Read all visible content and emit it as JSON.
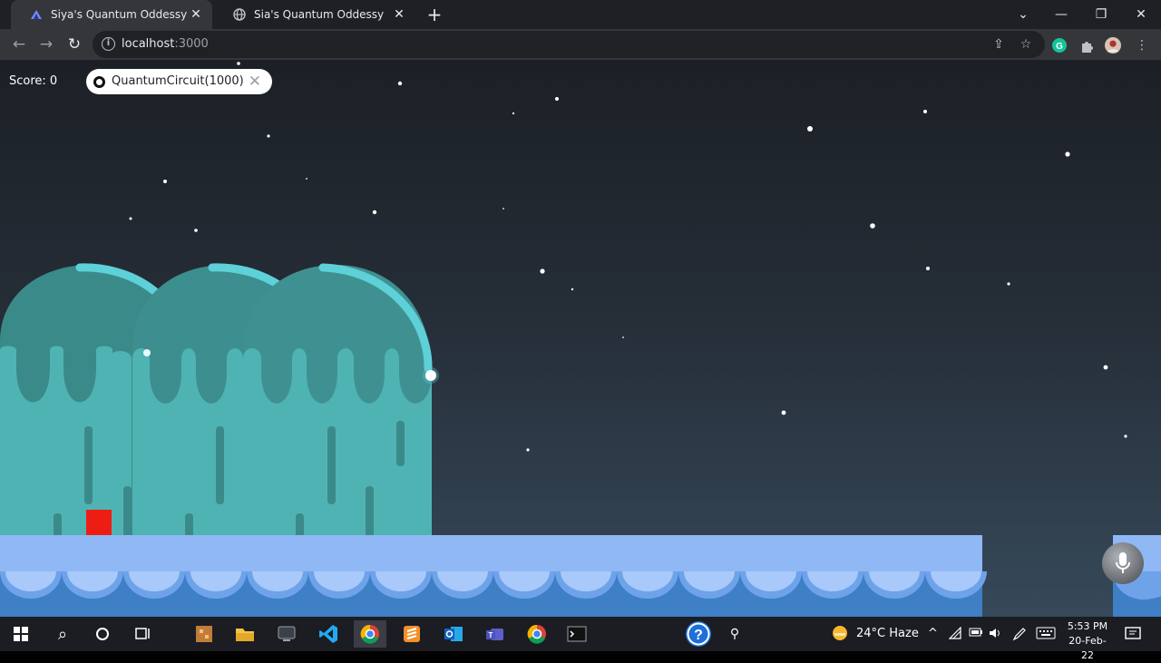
{
  "browser": {
    "tabs": [
      {
        "title": "Siya's Quantum Oddessy",
        "active": true
      },
      {
        "title": "Sia's Quantum Oddessy",
        "active": false
      }
    ],
    "new_tab": "+",
    "url_host": "localhost",
    "url_port": ":3000"
  },
  "game": {
    "score_label": "Score: 0",
    "search_value": "QuantumCircuit(1000)",
    "colors": {
      "jelly_body": "#4fb3b3",
      "jelly_dome": "#3d8c8c",
      "jelly_rim": "#5dd0d8",
      "ground": "#8fb8f5",
      "ground_dark": "#3e7fc6",
      "player": "#ee1d14"
    }
  },
  "taskbar": {
    "weather": "24°C  Haze",
    "time": "5:53 PM",
    "date": "20-Feb-22",
    "icons": [
      "windows-start-icon",
      "search-icon",
      "cortana-icon",
      "task-view-icon",
      "file-explorer-icon",
      "file-manager-icon",
      "screen-icon",
      "vscode-icon",
      "chrome-icon",
      "sublime-icon",
      "outlook-icon",
      "teams-icon",
      "chrome-icon",
      "terminal-icon",
      "help-icon",
      "people-icon"
    ]
  }
}
